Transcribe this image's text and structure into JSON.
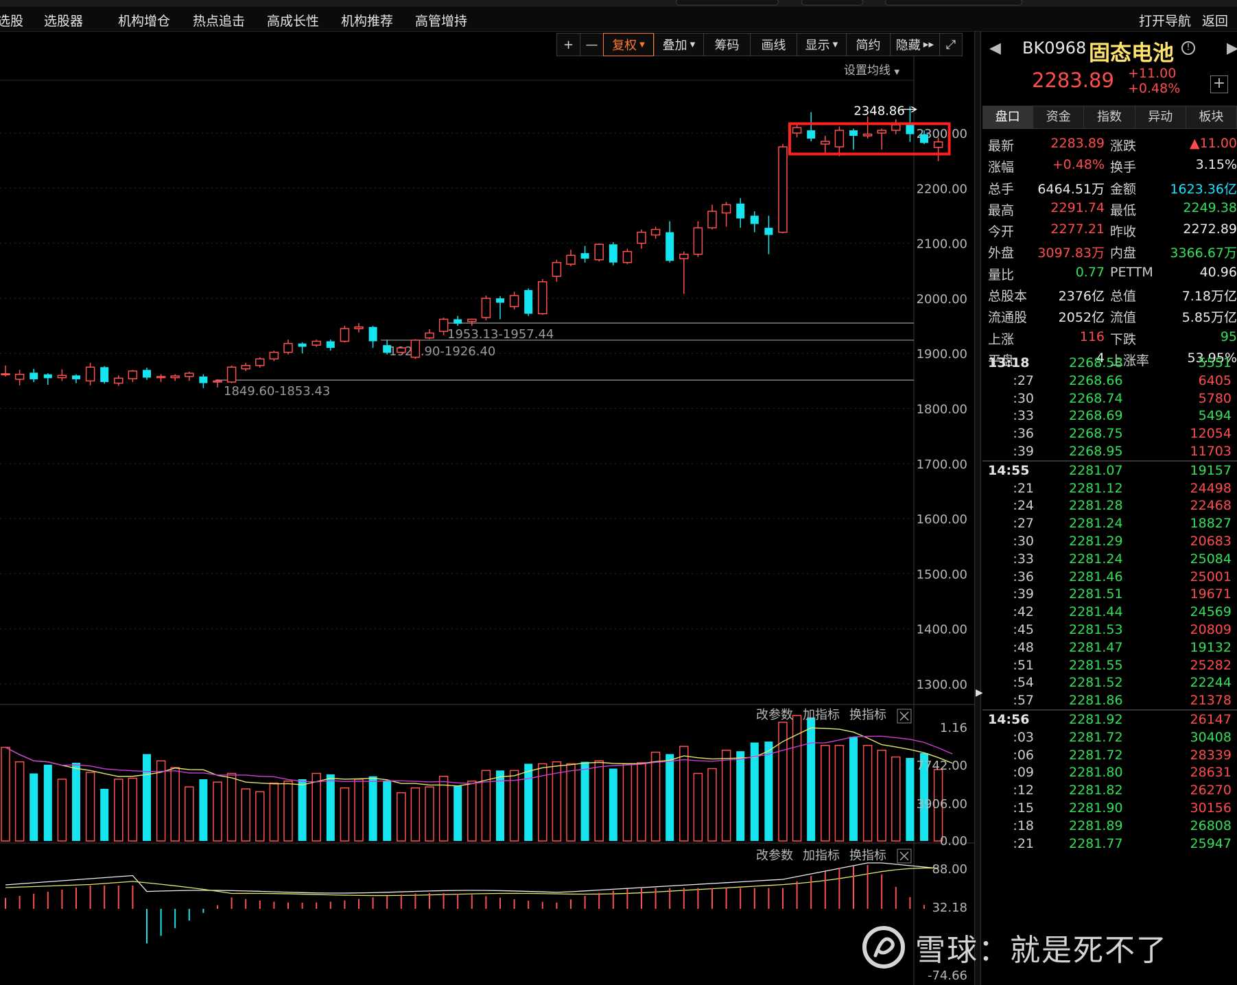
{
  "menu": {
    "items": [
      "选股",
      "选股器",
      "机构增仓",
      "热点追击",
      "高成长性",
      "机构推荐",
      "高管增持"
    ],
    "right_items": [
      "打开导航",
      "返回"
    ]
  },
  "toolbar": {
    "plus": "+",
    "minus": "—",
    "fuquan": "复权",
    "diejia": "叠加",
    "chouma": "筹码",
    "huaxian": "画线",
    "xianshi": "显示",
    "jianyue": "简约",
    "yincang": "隐藏"
  },
  "main_chart": {
    "set_ma_label": "设置均线",
    "high_label": "2348.86",
    "price_axis": [
      "2300.00",
      "2200.00",
      "2100.00",
      "2000.00",
      "1900.00",
      "1800.00",
      "1700.00",
      "1600.00",
      "1500.00",
      "1400.00",
      "1300.00"
    ],
    "gap_lines": [
      {
        "label": "1953.13-1957.44",
        "value": 1955
      },
      {
        "label": "1920.90-1926.40",
        "value": 1924
      },
      {
        "label": "1849.60-1853.43",
        "value": 1851.5
      }
    ]
  },
  "volume_panel": {
    "buttons": [
      "改参数",
      "加指标",
      "换指标"
    ],
    "axis": [
      "1.16",
      "7742.00",
      "3906.00",
      "0.00"
    ]
  },
  "macd_panel": {
    "buttons": [
      "改参数",
      "加指标",
      "换指标"
    ],
    "axis": [
      "88.00",
      "32.18",
      "-74.66"
    ]
  },
  "chart_data": {
    "type": "candlestick",
    "candles": [
      [
        1862,
        1863,
        1878,
        1858
      ],
      [
        1853,
        1862,
        1870,
        1842
      ],
      [
        1865,
        1853,
        1872,
        1848
      ],
      [
        1862,
        1855,
        1864,
        1843
      ],
      [
        1856,
        1860,
        1871,
        1850
      ],
      [
        1860,
        1853,
        1862,
        1846
      ],
      [
        1850,
        1875,
        1883,
        1842
      ],
      [
        1875,
        1848,
        1877,
        1845
      ],
      [
        1846,
        1855,
        1860,
        1841
      ],
      [
        1854,
        1868,
        1870,
        1848
      ],
      [
        1870,
        1856,
        1874,
        1852
      ],
      [
        1856,
        1858,
        1862,
        1848
      ],
      [
        1856,
        1859,
        1862,
        1850
      ],
      [
        1858,
        1864,
        1867,
        1850
      ],
      [
        1858,
        1846,
        1862,
        1837
      ],
      [
        1848,
        1850,
        1853,
        1838
      ],
      [
        1848,
        1875,
        1878,
        1846
      ],
      [
        1872,
        1878,
        1883,
        1868
      ],
      [
        1878,
        1890,
        1893,
        1874
      ],
      [
        1890,
        1902,
        1905,
        1886
      ],
      [
        1902,
        1918,
        1925,
        1898
      ],
      [
        1918,
        1912,
        1920,
        1900
      ],
      [
        1915,
        1922,
        1925,
        1912
      ],
      [
        1922,
        1910,
        1925,
        1905
      ],
      [
        1922,
        1945,
        1950,
        1920
      ],
      [
        1945,
        1948,
        1955,
        1938
      ],
      [
        1948,
        1922,
        1950,
        1910
      ],
      [
        1915,
        1901,
        1925,
        1898
      ],
      [
        1902,
        1910,
        1912,
        1900
      ],
      [
        1893,
        1924,
        1926,
        1890
      ],
      [
        1928,
        1937,
        1944,
        1926
      ],
      [
        1940,
        1962,
        1965,
        1933
      ],
      [
        1962,
        1954,
        1968,
        1950
      ],
      [
        1958,
        1962,
        1963,
        1950
      ],
      [
        1965,
        2000,
        2005,
        1960
      ],
      [
        2000,
        1992,
        2004,
        1962
      ],
      [
        1985,
        2005,
        2012,
        1980
      ],
      [
        2015,
        1972,
        2018,
        1968
      ],
      [
        1972,
        2030,
        2035,
        1970
      ],
      [
        2040,
        2065,
        2070,
        2030
      ],
      [
        2062,
        2078,
        2088,
        2058
      ],
      [
        2082,
        2072,
        2095,
        2065
      ],
      [
        2070,
        2098,
        2100,
        2067
      ],
      [
        2098,
        2065,
        2102,
        2060
      ],
      [
        2065,
        2085,
        2090,
        2062
      ],
      [
        2100,
        2120,
        2125,
        2090
      ],
      [
        2115,
        2125,
        2130,
        2108
      ],
      [
        2120,
        2068,
        2140,
        2065
      ],
      [
        2072,
        2080,
        2085,
        2008
      ],
      [
        2080,
        2128,
        2140,
        2075
      ],
      [
        2128,
        2158,
        2170,
        2125
      ],
      [
        2155,
        2170,
        2175,
        2130
      ],
      [
        2172,
        2145,
        2182,
        2128
      ],
      [
        2150,
        2135,
        2158,
        2120
      ],
      [
        2128,
        2115,
        2150,
        2080
      ],
      [
        2120,
        2275,
        2280,
        2118
      ],
      [
        2300,
        2310,
        2318,
        2292
      ],
      [
        2305,
        2290,
        2338,
        2285
      ],
      [
        2280,
        2285,
        2295,
        2262
      ],
      [
        2275,
        2305,
        2312,
        2258
      ],
      [
        2305,
        2295,
        2308,
        2270
      ],
      [
        2295,
        2298,
        2330,
        2290
      ],
      [
        2300,
        2305,
        2308,
        2270
      ],
      [
        2305,
        2315,
        2325,
        2298
      ],
      [
        2318,
        2298,
        2348.86,
        2284
      ],
      [
        2298,
        2282,
        2305,
        2280
      ],
      [
        2274,
        2284,
        2291.74,
        2249
      ]
    ],
    "volume_scale_max": 1.16
  },
  "panel": {
    "code": "BK0968",
    "name": "固态电池",
    "price": "2283.89",
    "change": "+11.00",
    "change_pct": "+0.48%",
    "tabs": [
      "盘口",
      "资金",
      "指数",
      "异动",
      "板块"
    ],
    "quote_rows": [
      {
        "l1": "最新",
        "v1": "2283.89",
        "c1": "red",
        "l2": "涨跌",
        "v2": "▲11.00",
        "c2": "red"
      },
      {
        "l1": "涨幅",
        "v1": "+0.48%",
        "c1": "red",
        "l2": "换手",
        "v2": "3.15%",
        "c2": "white"
      },
      {
        "l1": "总手",
        "v1": "6464.51万",
        "c1": "white",
        "l2": "金额",
        "v2": "1623.36亿",
        "c2": "cyan"
      },
      {
        "l1": "最高",
        "v1": "2291.74",
        "c1": "red",
        "l2": "最低",
        "v2": "2249.38",
        "c2": "green"
      },
      {
        "l1": "今开",
        "v1": "2277.21",
        "c1": "red",
        "l2": "昨收",
        "v2": "2272.89",
        "c2": "white"
      },
      {
        "l1": "外盘",
        "v1": "3097.83万",
        "c1": "red",
        "l2": "内盘",
        "v2": "3366.67万",
        "c2": "green"
      },
      {
        "l1": "量比",
        "v1": "0.77",
        "c1": "green",
        "l2": "PETTM",
        "v2": "40.96",
        "c2": "white"
      },
      {
        "l1": "总股本",
        "v1": "2376亿",
        "c1": "white",
        "l2": "总值",
        "v2": "7.18万亿",
        "c2": "white"
      },
      {
        "l1": "流通股",
        "v1": "2052亿",
        "c1": "white",
        "l2": "流值",
        "v2": "5.85万亿",
        "c2": "white"
      },
      {
        "l1": "上涨",
        "v1": "116",
        "c1": "red",
        "l2": "下跌",
        "v2": "95",
        "c2": "green"
      },
      {
        "l1": "平盘",
        "v1": "4",
        "c1": "white",
        "l2": "上涨率",
        "v2": "53.95%",
        "c2": "white"
      }
    ],
    "ticks": [
      {
        "t": "13:18",
        "p": "2268.58",
        "v": "5551",
        "c": "green",
        "hour": true
      },
      {
        "t": ":27",
        "p": "2268.66",
        "v": "6405",
        "c": "red"
      },
      {
        "t": ":30",
        "p": "2268.74",
        "v": "5780",
        "c": "red"
      },
      {
        "t": ":33",
        "p": "2268.69",
        "v": "5494",
        "c": "green"
      },
      {
        "t": ":36",
        "p": "2268.75",
        "v": "12054",
        "c": "red"
      },
      {
        "t": ":39",
        "p": "2268.95",
        "v": "11703",
        "c": "red"
      },
      {
        "t": "14:55",
        "p": "2281.07",
        "v": "19157",
        "c": "green",
        "hour": true,
        "sep": true
      },
      {
        "t": ":21",
        "p": "2281.12",
        "v": "24498",
        "c": "red"
      },
      {
        "t": ":24",
        "p": "2281.28",
        "v": "22468",
        "c": "red"
      },
      {
        "t": ":27",
        "p": "2281.24",
        "v": "18827",
        "c": "green"
      },
      {
        "t": ":30",
        "p": "2281.29",
        "v": "20683",
        "c": "red"
      },
      {
        "t": ":33",
        "p": "2281.24",
        "v": "25084",
        "c": "green"
      },
      {
        "t": ":36",
        "p": "2281.46",
        "v": "25001",
        "c": "red"
      },
      {
        "t": ":39",
        "p": "2281.51",
        "v": "19671",
        "c": "red"
      },
      {
        "t": ":42",
        "p": "2281.44",
        "v": "24569",
        "c": "green"
      },
      {
        "t": ":45",
        "p": "2281.53",
        "v": "20809",
        "c": "red"
      },
      {
        "t": ":48",
        "p": "2281.47",
        "v": "19132",
        "c": "green"
      },
      {
        "t": ":51",
        "p": "2281.55",
        "v": "25282",
        "c": "red"
      },
      {
        "t": ":54",
        "p": "2281.52",
        "v": "22244",
        "c": "green"
      },
      {
        "t": ":57",
        "p": "2281.86",
        "v": "21378",
        "c": "red"
      },
      {
        "t": "14:56",
        "p": "2281.92",
        "v": "26147",
        "c": "red",
        "hour": true,
        "sep": true
      },
      {
        "t": ":03",
        "p": "2281.72",
        "v": "30408",
        "c": "green"
      },
      {
        "t": ":06",
        "p": "2281.72",
        "v": "28339",
        "c": "red"
      },
      {
        "t": ":09",
        "p": "2281.80",
        "v": "28631",
        "c": "red"
      },
      {
        "t": ":12",
        "p": "2281.82",
        "v": "26270",
        "c": "red"
      },
      {
        "t": ":15",
        "p": "2281.90",
        "v": "30156",
        "c": "red"
      },
      {
        "t": ":18",
        "p": "2281.89",
        "v": "26808",
        "c": "green"
      },
      {
        "t": ":21",
        "p": "2281.77",
        "v": "25947",
        "c": "green"
      }
    ]
  },
  "watermark": {
    "text": "雪球：就是死不了"
  },
  "colors": {
    "up": "#ff5050",
    "down": "#16e5f0",
    "highlight_box": "#ff2020",
    "ma5": "#e8e86a",
    "ma10": "#d03cd6"
  }
}
